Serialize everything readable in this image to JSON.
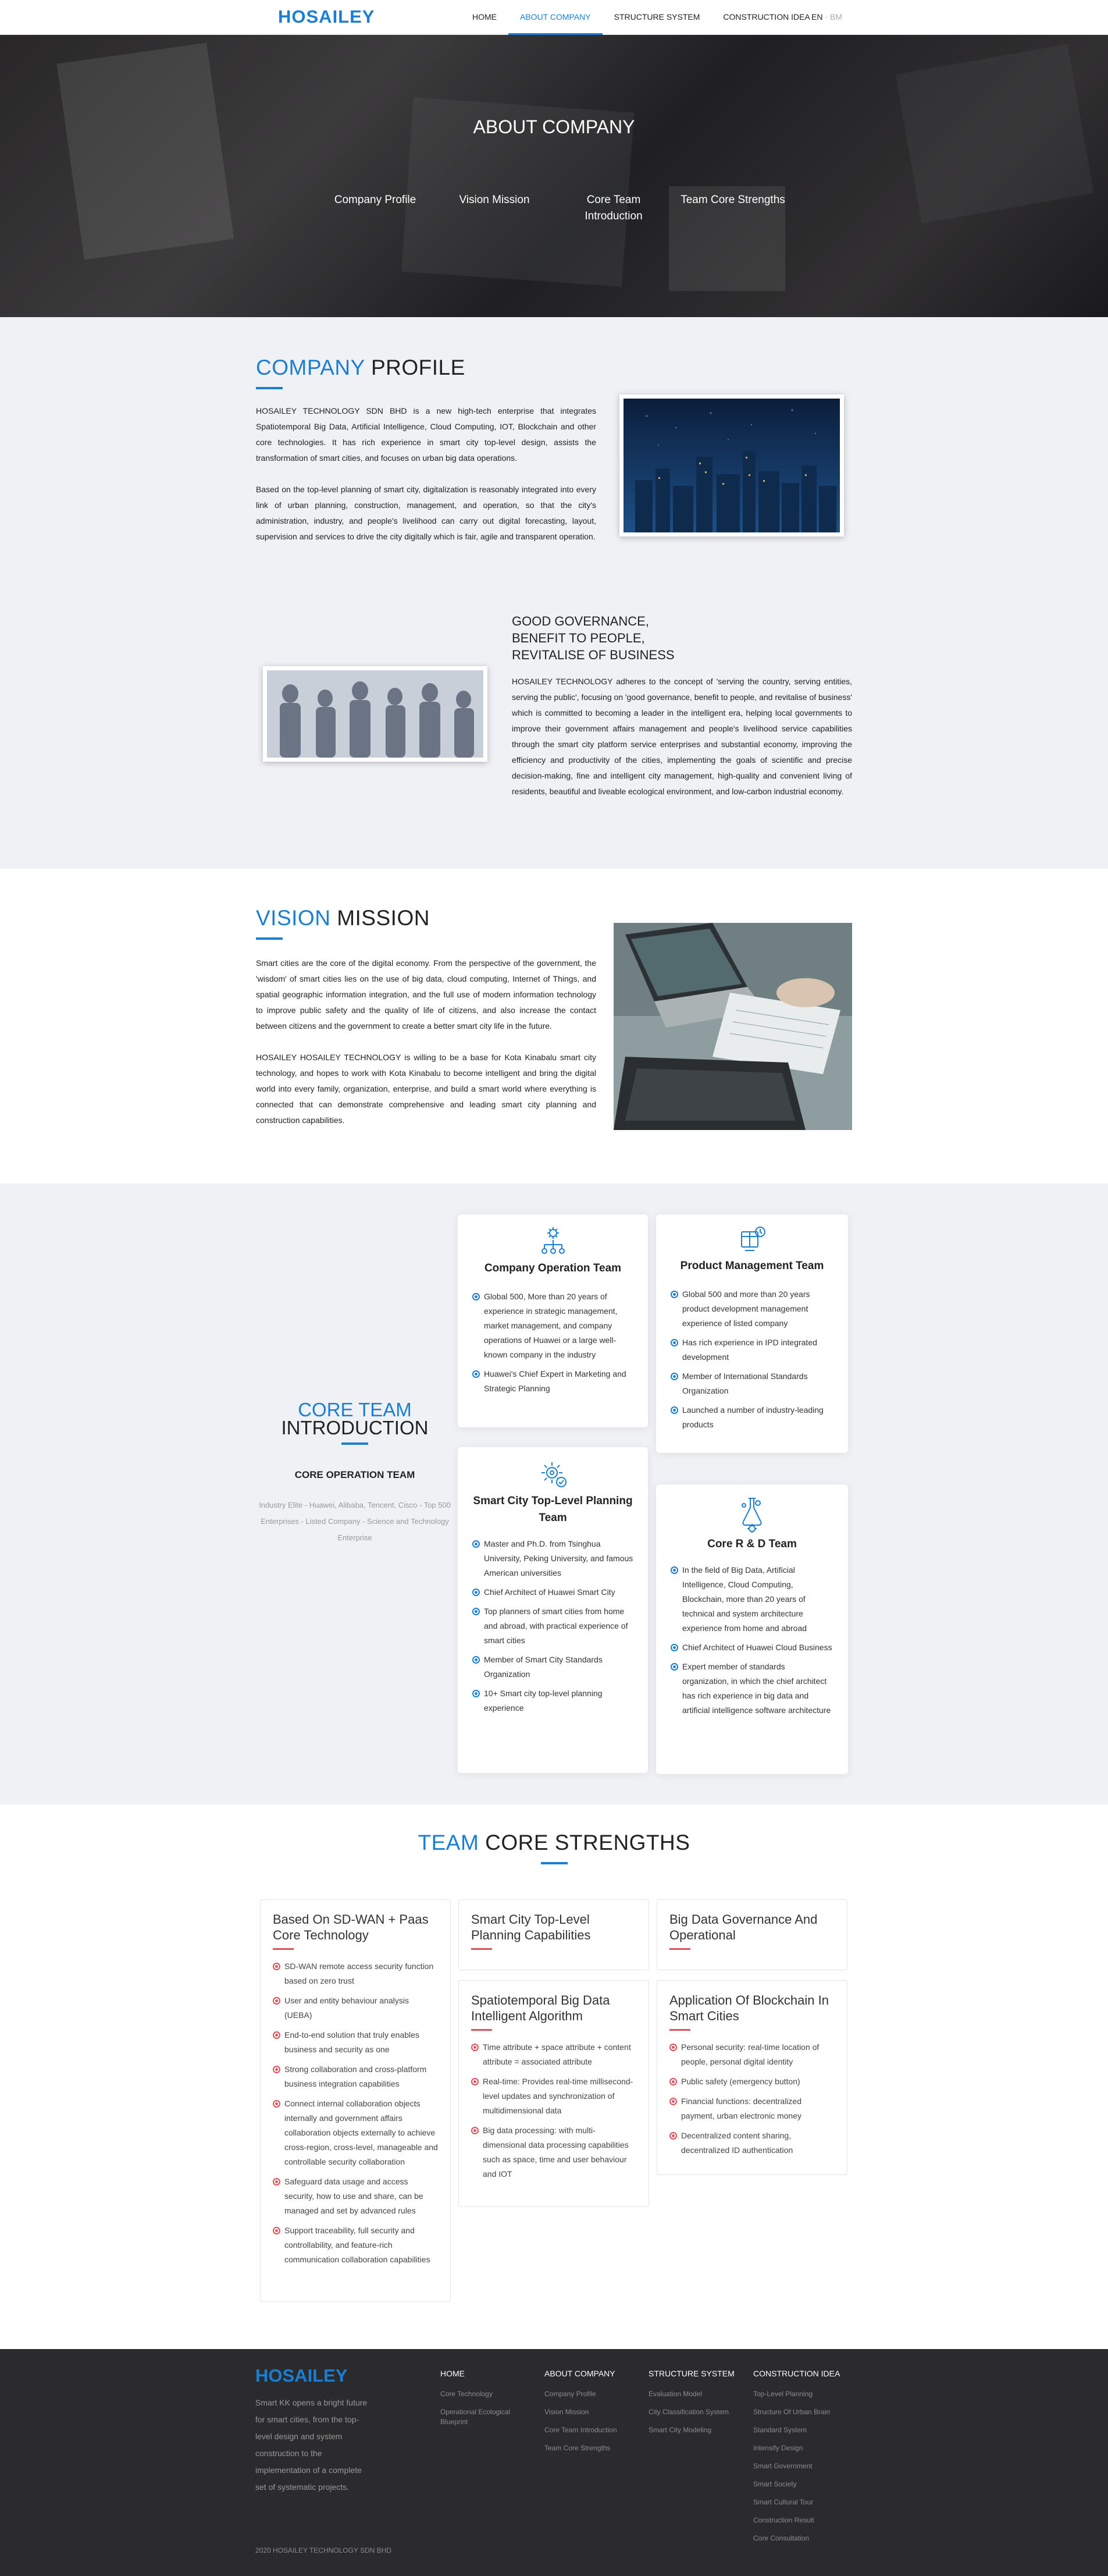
{
  "header": {
    "logo": "HOSAILEY",
    "menu": [
      "HOME",
      "ABOUT COMPANY",
      "STRUCTURE SYSTEM",
      "CONSTRUCTION IDEA"
    ],
    "lang_en": "EN",
    "lang_sep": "·",
    "lang_bm": "BM"
  },
  "hero": {
    "title": "ABOUT COMPANY",
    "tabs": [
      "Company Profile",
      "Vision Mission",
      "Core Team Introduction",
      "Team Core Strengths"
    ]
  },
  "profile": {
    "title_accent": "COMPANY",
    "title_rest": " PROFILE",
    "p1": "HOSAILEY TECHNOLOGY SDN BHD is a new high-tech enterprise that integrates Spatiotemporal Big Data, Artificial Intelligence, Cloud Computing, IOT, Blockchain and other core technologies. It has rich experience in smart city top-level design, assists the transformation of smart cities, and focuses on urban big data operations.",
    "p2": "Based on the top-level planning of smart city, digitalization is reasonably integrated into every link of urban planning, construction, management, and operation, so that the city's administration, industry, and people's livelihood can carry out digital forecasting, layout, supervision and services to drive the city digitally which is fair, agile and transparent operation.",
    "governance_title": "GOOD GOVERNANCE,\nBENEFIT TO PEOPLE,\nREVITALISE OF BUSINESS",
    "governance_text": "HOSAILEY TECHNOLOGY adheres to the concept of 'serving the country, serving entities, serving the public', focusing on 'good governance, benefit to people, and revitalise of business' which is committed to becoming a leader in the intelligent era, helping local governments to improve their government affairs management and people's livelihood service capabilities through the smart city platform service enterprises and substantial economy, improving the efficiency and productivity of the cities, implementing the goals of scientific and precise decision-making, fine and intelligent city management, high-quality and convenient living of residents, beautiful and liveable ecological environment, and low-carbon industrial economy."
  },
  "vision": {
    "title_accent": "VISION",
    "title_rest": " MISSION",
    "p1": "Smart cities are the core of the digital economy. From the perspective of the government, the 'wisdom' of smart cities lies on the use of big data, cloud computing, Internet of Things, and spatial geographic information integration, and the full use of modern information technology to improve public safety and the quality of life of citizens, and also increase the contact between citizens and the government to create a better smart city life in the future.",
    "p2": "HOSAILEY HOSAILEY TECHNOLOGY is willing to be a base for Kota Kinabalu smart city technology, and hopes to work with Kota Kinabalu to become intelligent and bring the digital world into every family, organization, enterprise, and build a smart world where everything is connected that can demonstrate comprehensive and leading smart city planning and construction capabilities."
  },
  "core_team": {
    "title_accent": "CORE TEAM",
    "title_rest": "INTRODUCTION",
    "subtitle": "CORE OPERATION TEAM",
    "desc": "Industry Elite - Huawei, Alibaba, Tencent, Cisco - Top 500 Enterprises - Listed Company - Science and Technology Enterprise",
    "cards": [
      {
        "title": "Company Operation Team",
        "icon": "org-chart-icon",
        "items": [
          "Global 500, More than 20 years of experience in strategic management, market management, and company operations of Huawei or a large well-known company in the industry",
          "Huawei's Chief Expert in Marketing and Strategic Planning"
        ]
      },
      {
        "title": "Product Management Team",
        "icon": "product-box-icon",
        "items": [
          "Global 500 and more than 20 years product development management experience of listed company",
          "Has rich experience in IPD integrated development",
          "Member of International Standards Organization",
          "Launched a number of industry-leading products"
        ]
      },
      {
        "title": "Smart City Top-Level Planning Team",
        "icon": "gear-check-icon",
        "items": [
          "Master and Ph.D. from Tsinghua University, Peking University, and famous American universities",
          "Chief Architect of Huawei Smart City",
          "Top planners of smart cities from home and abroad, with practical experience of smart cities",
          "Member of Smart City Standards Organization",
          "10+ Smart city top-level planning experience"
        ]
      },
      {
        "title": "Core R & D Team",
        "icon": "flask-gear-icon",
        "items": [
          "In the field of Big Data, Artificial Intelligence, Cloud Computing, Blockchain, more than 20 years of technical and system architecture experience from home and abroad",
          "Chief Architect of Huawei Cloud Business",
          "Expert member of standards organization, in which the chief architect has rich experience in big data and artificial intelligence software architecture"
        ]
      }
    ]
  },
  "strengths": {
    "title_accent": "TEAM",
    "title_rest": " CORE STRENGTHS",
    "cards": [
      {
        "title": "Based On SD-WAN + Paas Core Technology",
        "items": [
          "SD-WAN remote access security function based on zero trust",
          "User and entity behaviour analysis (UEBA)",
          "End-to-end solution that truly enables business and security as one",
          "Strong collaboration and cross-platform business integration capabilities",
          "Connect internal collaboration objects internally and government affairs collaboration objects externally to achieve cross-region, cross-level, manageable and controllable security collaboration",
          "Safeguard data usage and access security, how to use and share, can be managed and set by advanced rules",
          "Support traceability, full security and controllability, and feature-rich communication collaboration capabilities"
        ]
      },
      {
        "title": "Smart City Top-Level Planning Capabilities",
        "items": []
      },
      {
        "title": "Big Data Governance And Operational",
        "items": []
      },
      {
        "title": "Spatiotemporal Big Data Intelligent Algorithm",
        "items": [
          "Time attribute + space attribute + content attribute = associated attribute",
          "Real-time: Provides real-time millisecond-level updates and synchronization of multidimensional data",
          "Big data processing: with multi-dimensional data processing capabilities such as space, time and user behaviour and IOT"
        ]
      },
      {
        "title": "Application Of Blockchain In Smart Cities",
        "items": [
          "Personal security: real-time location of people, personal digital identity",
          "Public safety (emergency button)",
          "Financial functions: decentralized payment, urban electronic money",
          "Decentralized content sharing, decentralized ID authentication"
        ]
      }
    ]
  },
  "footer": {
    "logo": "HOSAILEY",
    "desc": "Smart KK opens a bright future for smart cities, from the top-level design and system construction to the implementation of a complete set of systematic projects.",
    "cols": [
      {
        "title": "HOME",
        "links": [
          "Core Technology",
          "Operational Ecological Blueprint"
        ]
      },
      {
        "title": "ABOUT COMPANY",
        "links": [
          "Company Profile",
          "Vision Mission",
          "Core Team Introduction",
          "Team Core Strengths"
        ]
      },
      {
        "title": "STRUCTURE SYSTEM",
        "links": [
          "Evaluation Model",
          "City Classification System",
          "Smart City Modeling"
        ]
      },
      {
        "title": "CONSTRUCTION IDEA",
        "links": [
          "Top-Level Planning",
          "Structure Of Urban Brain",
          "Standard System",
          "Intensify Design",
          "Smart Government",
          "Smart Society",
          "Smart Cultural Tour",
          "Construction Result",
          "Core Consultation"
        ]
      }
    ],
    "copyright": "2020 HOSAILEY TECHNOLOGY SDN BHD"
  }
}
